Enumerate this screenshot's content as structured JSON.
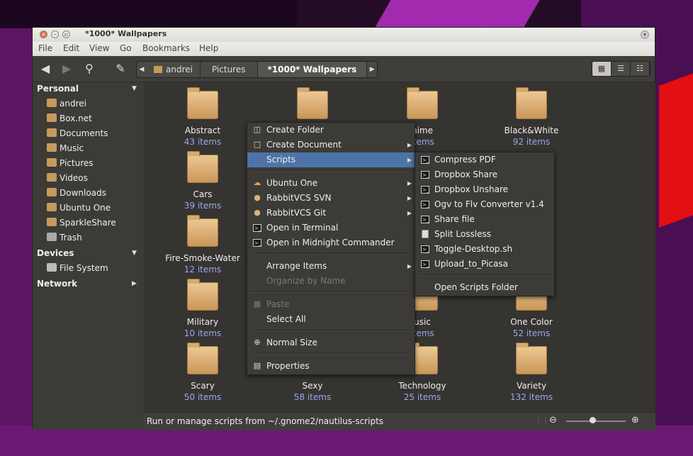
{
  "window": {
    "title": "*1000* Wallpapers",
    "close_glyph": "×",
    "min_glyph": "–",
    "max_glyph": "▫",
    "dropdown_glyph": "▾"
  },
  "menubar": [
    "File",
    "Edit",
    "View",
    "Go",
    "Bookmarks",
    "Help"
  ],
  "toolbar": {
    "breadcrumbs": [
      "andrei",
      "Pictures",
      "*1000* Wallpapers"
    ],
    "active_crumb": "*1000* Wallpapers"
  },
  "sidebar": {
    "personal_label": "Personal",
    "personal_items": [
      "andrei",
      "Box.net",
      "Documents",
      "Music",
      "Pictures",
      "Videos",
      "Downloads",
      "Ubuntu One",
      "SparkleShare",
      "Trash"
    ],
    "devices_label": "Devices",
    "device_items": [
      "File System"
    ],
    "network_label": "Network"
  },
  "folders": [
    {
      "name": "Abstract",
      "count": "43 items"
    },
    {
      "name": "",
      "count": ""
    },
    {
      "name": "nime",
      "count": "items"
    },
    {
      "name": "Black&White",
      "count": "92 items"
    },
    {
      "name": "Cars",
      "count": "39 items"
    },
    {
      "name": "Fire-Smoke-Water",
      "count": "12 items"
    },
    {
      "name": "Military",
      "count": "10 items"
    },
    {
      "name": "usic",
      "count": "items"
    },
    {
      "name": "One Color",
      "count": "52 items"
    },
    {
      "name": "Scary",
      "count": "50 items"
    },
    {
      "name": "Sexy",
      "count": "58 items"
    },
    {
      "name": "Technology",
      "count": "25 items"
    },
    {
      "name": "Variety",
      "count": "132 items"
    }
  ],
  "context_menu": {
    "items": [
      {
        "label": "Create Folder",
        "icon": "folder-new-icon",
        "submenu": false,
        "disabled": false
      },
      {
        "label": "Create Document",
        "icon": "document-new-icon",
        "submenu": true,
        "disabled": false
      },
      {
        "label": "Scripts",
        "icon": "",
        "submenu": true,
        "disabled": false,
        "highlighted": true
      },
      {
        "label": "Ubuntu One",
        "icon": "ubuntu-one-icon",
        "submenu": true,
        "disabled": false
      },
      {
        "label": "RabbitVCS SVN",
        "icon": "rabbit-icon",
        "submenu": true,
        "disabled": false
      },
      {
        "label": "RabbitVCS Git",
        "icon": "rabbit-icon",
        "submenu": true,
        "disabled": false
      },
      {
        "label": "Open in Terminal",
        "icon": "terminal-icon",
        "submenu": false,
        "disabled": false
      },
      {
        "label": "Open in Midnight Commander",
        "icon": "terminal-icon",
        "submenu": false,
        "disabled": false
      },
      {
        "label": "Arrange Items",
        "icon": "",
        "submenu": true,
        "disabled": false
      },
      {
        "label": "Organize by Name",
        "icon": "",
        "submenu": false,
        "disabled": true
      },
      {
        "label": "Paste",
        "icon": "paste-icon",
        "submenu": false,
        "disabled": true
      },
      {
        "label": "Select All",
        "icon": "",
        "submenu": false,
        "disabled": false
      },
      {
        "label": "Normal Size",
        "icon": "zoom-icon",
        "submenu": false,
        "disabled": false
      },
      {
        "label": "Properties",
        "icon": "properties-icon",
        "submenu": false,
        "disabled": false
      }
    ]
  },
  "scripts_menu": {
    "items": [
      "Compress PDF",
      "Dropbox Share",
      "Dropbox Unshare",
      "Ogv to Flv Converter v1.4",
      "Share file",
      "Split Lossless",
      "Toggle-Desktop.sh",
      "Upload_to_Picasa"
    ],
    "open_folder_label": "Open Scripts Folder"
  },
  "status": {
    "text": "Run or manage scripts from ~/.gnome2/nautilus-scripts",
    "zoom_level": 0.45
  }
}
